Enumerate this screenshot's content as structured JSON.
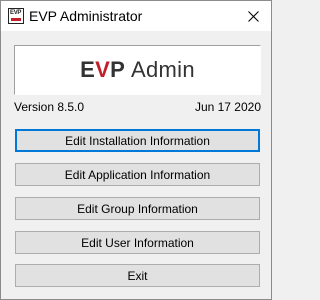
{
  "window": {
    "title": "EVP Administrator",
    "icon": "evp-app-icon",
    "close_icon": "close-icon"
  },
  "banner": {
    "logo_prefix": "E",
    "logo_accent": "V",
    "logo_suffix": "P",
    "logo_word": "Admin",
    "accent_color": "#c21f2a"
  },
  "info": {
    "version": "Version 8.5.0",
    "date": "Jun 17 2020"
  },
  "buttons": {
    "installation": "Edit Installation Information",
    "application": "Edit Application Information",
    "group": "Edit Group Information",
    "user": "Edit User Information",
    "exit": "Exit"
  }
}
